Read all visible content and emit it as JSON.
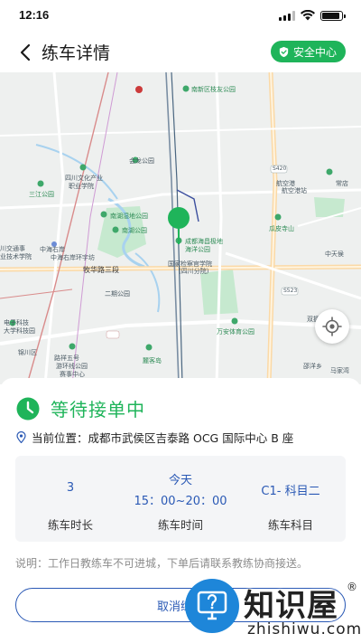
{
  "status_bar": {
    "time": "12:16",
    "battery_level": 0.9
  },
  "header": {
    "title": "练车详情",
    "safety_label": "安全中心"
  },
  "map": {
    "labels": [
      "南新区枝友公园",
      "会龙公园",
      "四川文化产业",
      "职业学院",
      "三江公园",
      "南湖湿地公园",
      "南湖公园",
      "成都海昌极地",
      "海洋公园",
      "国家检察官学院",
      "(四川分院)",
      "牧华路三段",
      "万安体育公园",
      "中海右岸环宇坊",
      "中海右岸",
      "航空港",
      "瓜皮寺山",
      "常店",
      "麓客岛",
      "邵洋乡",
      "电子科技",
      "大学科技园",
      "川交通事",
      "业技术学院",
      "双拥岛",
      "马家湾",
      "中天侯",
      "路祥五号",
      "游环线公园",
      "赛事中心",
      "S420",
      "S523",
      "二期公园",
      "锦川区",
      "航空港站"
    ]
  },
  "order": {
    "status": "等待接单中",
    "location_label": "当前位置：",
    "location": "成都市武侯区吉泰路 OCG 国际中心 B 座",
    "duration_value": "3",
    "duration_label": "练车时长",
    "time_day": "今天",
    "time_range": "15：00~20：00",
    "time_label": "练车时间",
    "subject_value": "C1- 科目二",
    "subject_label": "练车科目",
    "note": "说明：工作日教练车不可进城，下单后请联系教练协商接送。",
    "cancel_label": "取消练车"
  },
  "watermark": {
    "brand": "知识屋",
    "domain": "zhishiwu.com",
    "reg": "®"
  },
  "colors": {
    "accent_green": "#1fb45a",
    "accent_blue": "#2a59b5",
    "map_bg": "#eef0ef"
  }
}
